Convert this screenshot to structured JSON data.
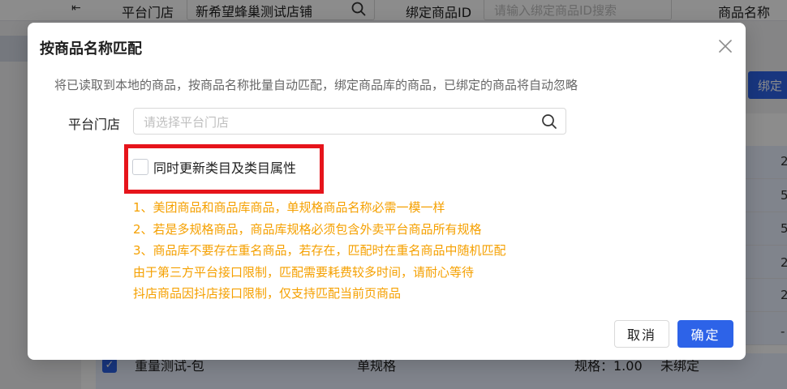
{
  "background": {
    "filters": {
      "store_label": "平台门店",
      "store_value": "新希望蜂巢测试店铺",
      "bound_id_label": "绑定商品ID",
      "bound_id_placeholder": "请输入绑定商品ID搜索",
      "product_name_label": "商品名称"
    },
    "bind_button_label": "绑定",
    "right_digits": [
      "2",
      "5",
      "5",
      "2",
      "2",
      "-"
    ],
    "bottom_row": {
      "name": "重量测试-包",
      "spec_type": "单规格",
      "spec": "规格：1.00",
      "status": "未绑定"
    }
  },
  "modal": {
    "title": "按商品名称匹配",
    "description": "将已读取到本地的商品，按商品名称批量自动匹配，绑定商品库的商品，已绑定的商品将自动忽略",
    "store_label": "平台门店",
    "store_placeholder": "请选择平台门店",
    "checkbox_label": "同时更新类目及类目属性",
    "notes": [
      "1、美团商品和商品库商品，单规格商品名称必需一模一样",
      "2、若是多规格商品，商品库规格必须包含外卖平台商品所有规格",
      "3、商品库不要存在重名商品，若存在，匹配时在重名商品中随机匹配",
      "由于第三方平台接口限制，匹配需要耗费较多时间，请耐心等待",
      "抖店商品因抖店接口限制，仅支持匹配当前页商品"
    ],
    "cancel_label": "取消",
    "ok_label": "确定"
  },
  "colors": {
    "primary": "#2d63e8",
    "warning_text": "#f5a000",
    "highlight": "#e6141b"
  },
  "icons": [
    "collapse-icon",
    "search-icon",
    "close-icon",
    "check-icon"
  ]
}
